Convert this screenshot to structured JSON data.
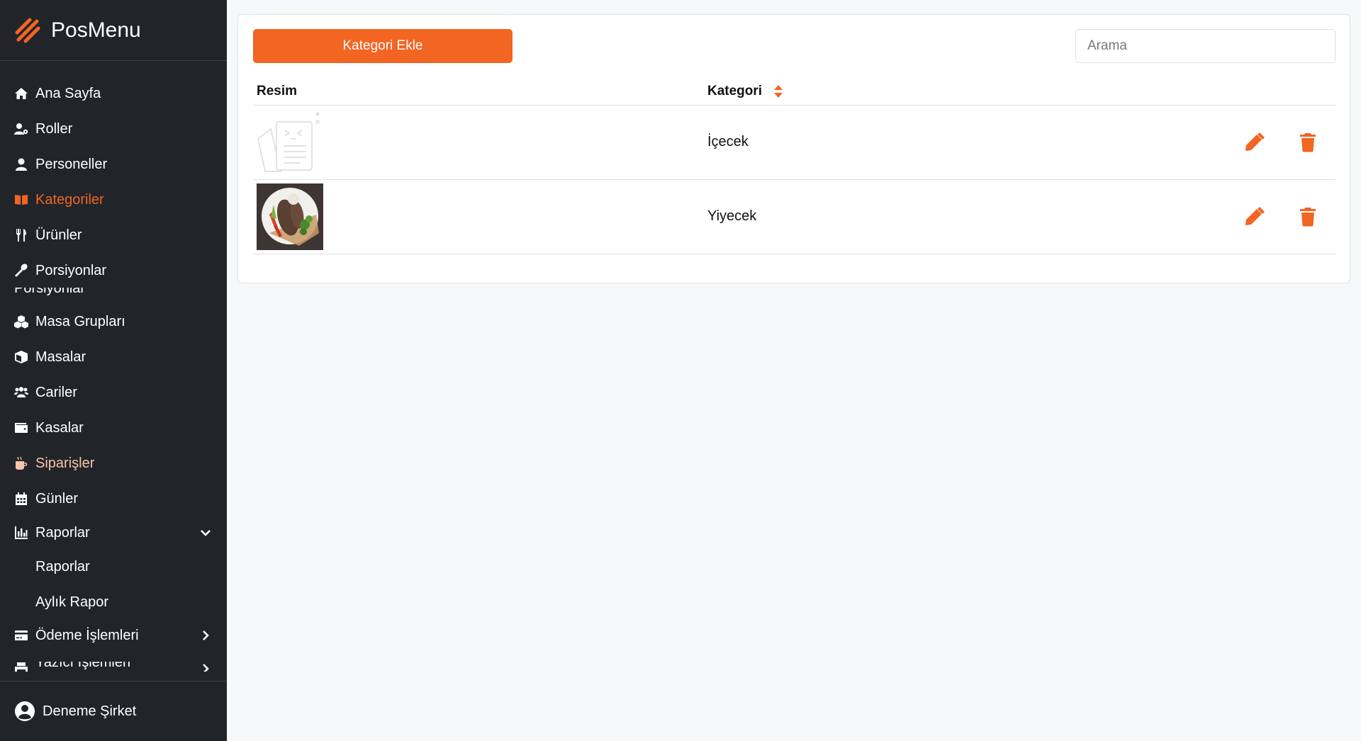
{
  "app": {
    "name": "PosMenu"
  },
  "colors": {
    "accent": "#f26522",
    "sidebar_bg": "#212529",
    "page_bg": "#f7f8fa"
  },
  "sidebar": {
    "items": [
      {
        "label": "Ana Sayfa",
        "icon": "home-icon"
      },
      {
        "label": "Roller",
        "icon": "user-gear-icon"
      },
      {
        "label": "Personeller",
        "icon": "user-icon"
      },
      {
        "label": "Kategoriler",
        "icon": "book-open-icon",
        "active": true
      },
      {
        "label": "Ürünler",
        "icon": "utensils-icon"
      },
      {
        "label": "Porsiyonlar",
        "icon": "spoon-icon"
      },
      {
        "label": "Masa Grupları",
        "icon": "cubes-icon"
      },
      {
        "label": "Masalar",
        "icon": "cube-icon"
      },
      {
        "label": "Cariler",
        "icon": "users-icon"
      },
      {
        "label": "Kasalar",
        "icon": "wallet-icon"
      },
      {
        "label": "Siparişler",
        "icon": "mug-icon"
      },
      {
        "label": "Günler",
        "icon": "calendar-icon"
      },
      {
        "label": "Raporlar",
        "icon": "chart-icon",
        "expanded": true
      },
      {
        "label": "Raporlar",
        "sub": true
      },
      {
        "label": "Aylık Rapor",
        "sub": true
      },
      {
        "label": "Ödeme İşlemleri",
        "icon": "credit-card-icon"
      }
    ],
    "ghost_top": "Porsiyonlar",
    "ghost_bottom": "Yazıcı İşlemleri",
    "user": "Deneme Şirket"
  },
  "main": {
    "add_button": "Kategori Ekle",
    "search_placeholder": "Arama",
    "columns": {
      "image": "Resim",
      "category": "Kategori"
    },
    "rows": [
      {
        "category": "İçecek",
        "image": "placeholder-illustration"
      },
      {
        "category": "Yiyecek",
        "image": "food-plate-photo"
      }
    ]
  }
}
